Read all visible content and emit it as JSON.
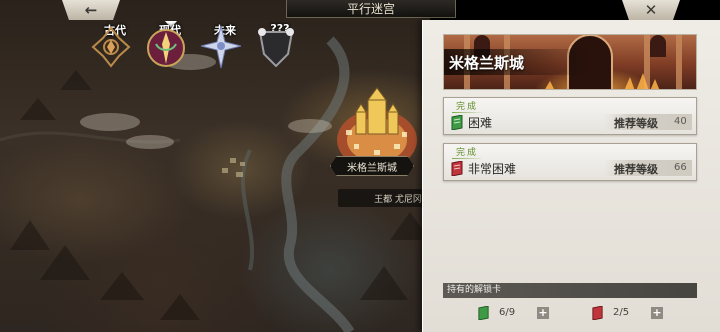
{
  "header": {
    "title": "平行迷宫",
    "back_icon": "←",
    "close_icon": "✕"
  },
  "eras": [
    {
      "label": "古代",
      "icon": "ancient-emblem-icon"
    },
    {
      "label": "现代",
      "icon": "modern-emblem-icon",
      "selected": true
    },
    {
      "label": "未来",
      "icon": "future-emblem-icon"
    },
    {
      "label": "???",
      "icon": "unknown-emblem-icon"
    }
  ],
  "map": {
    "castle_label": "米格兰斯城",
    "capital_label": "王都 尤尼冈"
  },
  "panel": {
    "city_name": "米格兰斯城",
    "difficulties": [
      {
        "status": "完成",
        "name": "困难",
        "rec_label": "推荐等级",
        "rec_level": "40",
        "book_color": "#3f9a45"
      },
      {
        "status": "完成",
        "name": "非常困难",
        "rec_label": "推荐等级",
        "rec_level": "66",
        "book_color": "#c0353c"
      }
    ],
    "keys_header": "持有的解锁卡",
    "keys": [
      {
        "count": "6/9",
        "book_color": "#3f9a45",
        "plus": "+"
      },
      {
        "count": "2/5",
        "book_color": "#c0353c",
        "plus": "+"
      }
    ]
  }
}
